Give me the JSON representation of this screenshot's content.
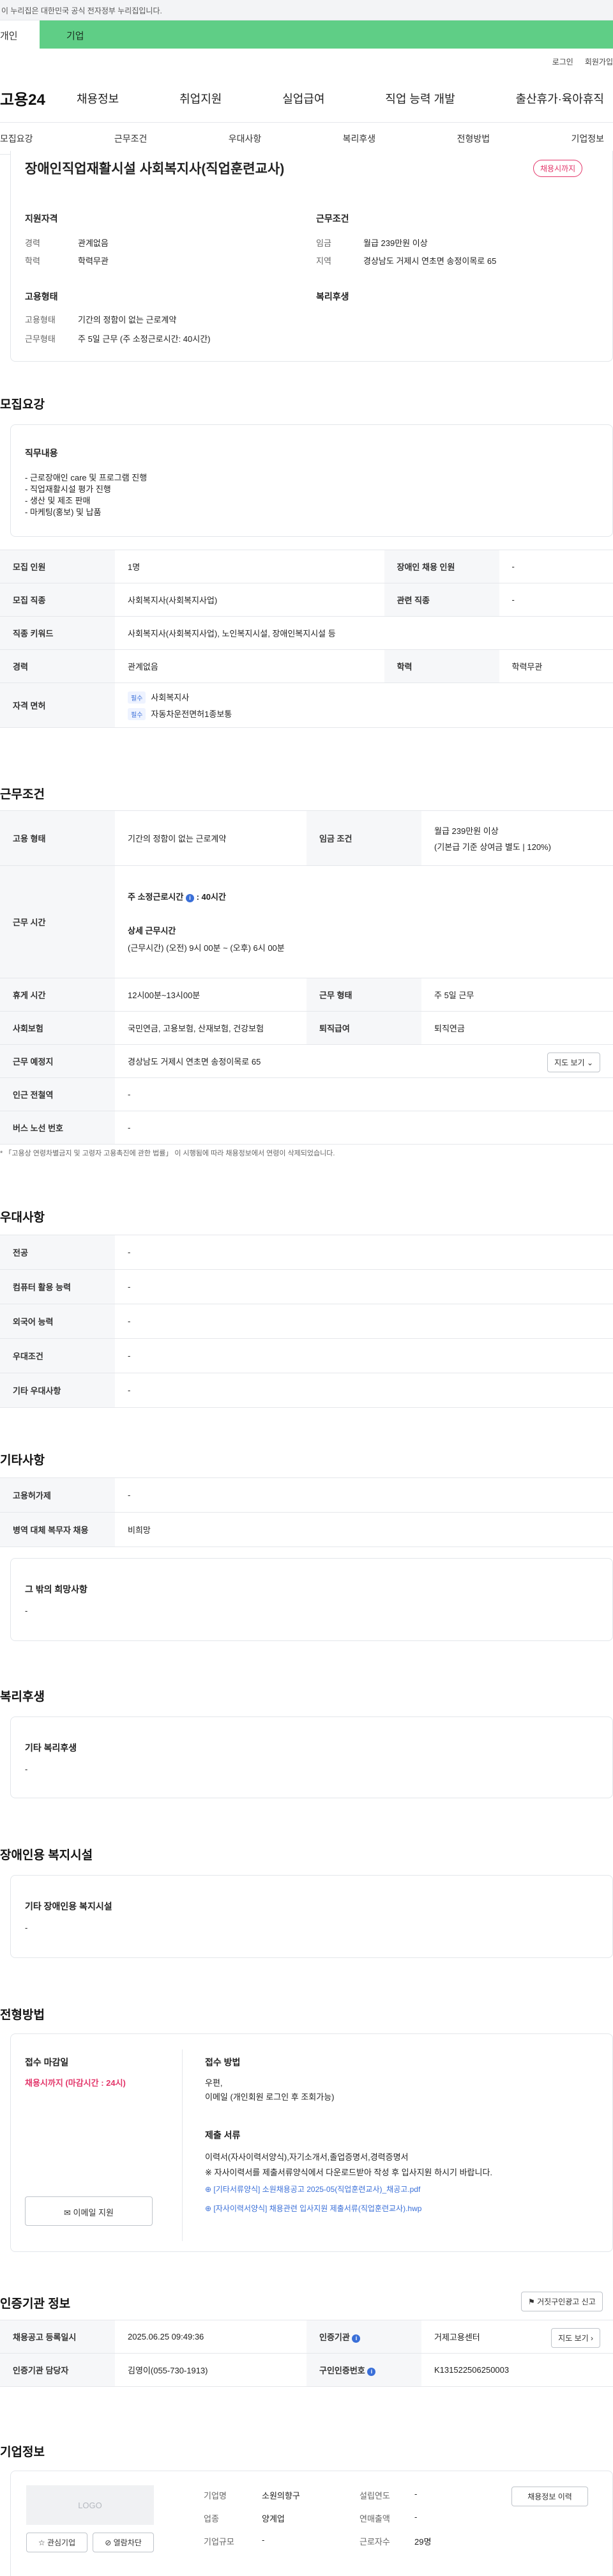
{
  "banner": "이 누리집은 대한민국 공식 전자정부 누리집입니다.",
  "tabs": {
    "individual": "개인",
    "business": "기업"
  },
  "util": {
    "login": "로그인",
    "join": "회원가입"
  },
  "logo": "고용24",
  "gnb": [
    "채용정보",
    "취업지원",
    "실업급여",
    "직업 능력 개발",
    "출산휴가·육아휴직"
  ],
  "subnav": [
    "모집요강",
    "근무조건",
    "우대사항",
    "복리후생",
    "전형방법",
    "기업정보"
  ],
  "job": {
    "title": "장애인직업재활시설 사회복지사(직업훈련교사)",
    "deadline": "채용시까지",
    "qual_title": "지원자격",
    "career_lbl": "경력",
    "career": "관계없음",
    "edu_lbl": "학력",
    "edu": "학력무관",
    "cond_title": "근무조건",
    "wage_lbl": "임금",
    "wage": "월급 239만원 이상",
    "area_lbl": "지역",
    "area": "경상남도 거제시 연초면 송정이목로 65",
    "emp_title": "고용형태",
    "emp_lbl": "고용형태",
    "emp": "기간의 정함이 없는 근로계약",
    "work_lbl": "근무형태",
    "work": "주 5일 근무 (주 소정근로시간: 40시간)",
    "welfare_title": "복리후생"
  },
  "recruit": {
    "title": "모집요강",
    "duty_title": "직무내용",
    "duty": [
      "- 근로장애인 care 및 프로그램 진행",
      "- 직업재활시설 평가 진행",
      "- 생산 및 제조 판매",
      "- 마케팅(홍보) 및 납품"
    ],
    "rows": {
      "count_lbl": "모집 인원",
      "count": "1명",
      "disabled_lbl": "장애인 채용 인원",
      "disabled": "-",
      "job_lbl": "모집 직종",
      "job": "사회복지사(사회복지사업)",
      "rel_lbl": "관련 직종",
      "rel": "-",
      "kw_lbl": "직종 키워드",
      "kw": "사회복지사(사회복지사업), 노인복지시설, 장애인복지시설 등",
      "career_lbl": "경력",
      "career": "관계없음",
      "edu_lbl": "학력",
      "edu": "학력무관",
      "lic_lbl": "자격 면허",
      "req": "필수",
      "lic1": "사회복지사",
      "lic2": "자동차운전면허1종보통"
    }
  },
  "cond": {
    "title": "근무조건",
    "emp_lbl": "고용 형태",
    "emp": "기간의 정함이 없는 근로계약",
    "wage_lbl": "임금 조건",
    "wage1": "월급 239만원 이상",
    "wage2": "(기본급 기준 상여금 별도 | 120%)",
    "hours_lbl": "근무 시간",
    "hours_main": "주 소정근로시간",
    "hours_val": ": 40시간",
    "detail_lbl": "상세 근무시간",
    "detail": "(근무시간) (오전) 9시 00분 ~ (오후) 6시 00분",
    "break_lbl": "휴게 시간",
    "break": "12시00분~13시00분",
    "type_lbl": "근무 형태",
    "type": "주 5일 근무",
    "ins_lbl": "사회보험",
    "ins": "국민연금, 고용보험, 산재보험, 건강보험",
    "ret_lbl": "퇴직급여",
    "ret": "퇴직연금",
    "place_lbl": "근무 예정지",
    "place": "경상남도 거제시 연초면 송정이목로 65",
    "map_btn": "지도 보기",
    "subway_lbl": "인근 전철역",
    "subway": "-",
    "bus_lbl": "버스 노선 번호",
    "bus": "-",
    "note": "* 「고용상 연령차별금지 및 고령자 고용촉진에 관한 법률」 이 시행됨에 따라 채용정보에서 연령이 삭제되었습니다."
  },
  "pref": {
    "title": "우대사항",
    "rows": [
      [
        "전공",
        "-"
      ],
      [
        "컴퓨터 활용 능력",
        "-"
      ],
      [
        "외국어 능력",
        "-"
      ],
      [
        "우대조건",
        "-"
      ],
      [
        "기타 우대사항",
        "-"
      ]
    ]
  },
  "etc": {
    "title": "기타사항",
    "rows": [
      [
        "고용허가제",
        "-"
      ],
      [
        "병역 대체 복무자 채용",
        "비희망"
      ]
    ],
    "hope_title": "그 밖의 희망사항",
    "hope": "-"
  },
  "welfare": {
    "title": "복리후생",
    "sub": "기타 복리후생",
    "val": "-"
  },
  "dis": {
    "title": "장애인용 복지시설",
    "sub": "기타 장애인용 복지시설",
    "val": "-"
  },
  "process": {
    "title": "전형방법",
    "period_title": "접수 마감일",
    "period": "채용시까지 (마감시간 : 24시)",
    "apply_btn": "이메일 지원",
    "method_title": "접수 방법",
    "method1": "우편,",
    "method2": "이메일 (개인회원 로그인 후 조회가능)",
    "docs_title": "제출 서류",
    "docs1": "이력서(자사이력서양식),자기소개서,졸업증명서,경력증명서",
    "docs2": "※ 자사이력서를 제출서류양식에서 다운로드받아 작성 후 입사지원 하시기 바랍니다.",
    "file1": "[기타서류양식] 소원채용공고 2025-05(직업훈련교사)_채공고.pdf",
    "file2": "[자사이력서양식] 채용관련 입사지원 제출서류(직업훈련교사).hwp"
  },
  "cert": {
    "title": "인증기관 정보",
    "report_btn": "거짓구인광고 신고",
    "reg_lbl": "채용공고 등록일시",
    "reg": "2025.06.25 09:49:36",
    "org_lbl": "인증기관",
    "org": "거제고용센터",
    "mgr_lbl": "인증기관 담당자",
    "mgr": "김영이(055-730-1913)",
    "no_lbl": "구인인증번호",
    "no": "K131522506250003",
    "map_btn": "지도 보기"
  },
  "company": {
    "title": "기업정보",
    "logo": "LOGO",
    "fav_btn": "관심기업",
    "block_btn": "열람차단",
    "name_lbl": "기업명",
    "name": "소원의향구",
    "industry_lbl": "업종",
    "industry": "양계업",
    "size_lbl": "기업규모",
    "size": "-",
    "year_lbl": "설립연도",
    "year": "-",
    "sales_lbl": "연매출액",
    "sales": "-",
    "emp_lbl": "근로자수",
    "emp": "29명",
    "hist_btn": "채용정보 이력"
  },
  "colors": {
    "biz_tab": "#5fce86",
    "badge": "#e3366a",
    "link": "#3a6fd8"
  }
}
